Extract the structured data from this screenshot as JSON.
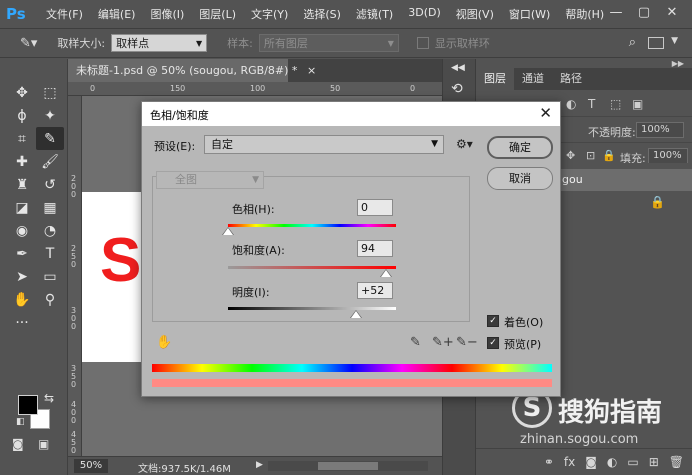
{
  "app": {
    "logo": "Ps",
    "menu": [
      "文件(F)",
      "编辑(E)",
      "图像(I)",
      "图层(L)",
      "文字(Y)",
      "选择(S)",
      "滤镜(T)",
      "3D(D)",
      "视图(V)",
      "窗口(W)",
      "帮助(H)"
    ],
    "window_controls": [
      "—",
      "▢",
      "✕"
    ]
  },
  "options_bar": {
    "sample_size_label": "取样大小:",
    "sample_size_value": "取样点",
    "sample_label": "样本:",
    "sample_value": "所有图层",
    "show_ring_label": "显示取样环"
  },
  "document": {
    "tab_title": "未标题-1.psd @ 50% (sougou, RGB/8#) *",
    "tab_close": "×",
    "canvas_letter": "S",
    "zoom": "50%",
    "doc_info": "文档:937.5K/1.46M",
    "ruler_h": [
      "0",
      "150",
      "100",
      "50",
      "0"
    ],
    "ruler_v": [
      "2",
      "0",
      "0",
      "2",
      "5",
      "0",
      "3",
      "0",
      "0",
      "3",
      "5",
      "0",
      "4",
      "0",
      "0",
      "4",
      "5",
      "0"
    ]
  },
  "layers_panel": {
    "tabs": [
      "图层",
      "通道",
      "路径"
    ],
    "opacity_label": "不透明度:",
    "opacity_value": "100%",
    "fill_label": "填充:",
    "fill_value": "100%",
    "layer_name": "gou"
  },
  "dialog": {
    "title": "色相/饱和度",
    "close": "✕",
    "preset_label": "预设(E):",
    "preset_value": "自定",
    "ok_button": "确定",
    "cancel_button": "取消",
    "channel_value": "全图",
    "hue": {
      "label": "色相(H):",
      "value": "0",
      "position": 0.0
    },
    "saturation": {
      "label": "饱和度(A):",
      "value": "94",
      "position": 0.94
    },
    "lightness": {
      "label": "明度(I):",
      "value": "+52",
      "position": 0.76
    },
    "colorize": {
      "label": "着色(O)",
      "checked": true
    },
    "preview": {
      "label": "预览(P)",
      "checked": true
    },
    "tint_color": "#ff8a84"
  },
  "watermark": {
    "text": "搜狗指南",
    "url": "zhinan.sogou.com"
  }
}
